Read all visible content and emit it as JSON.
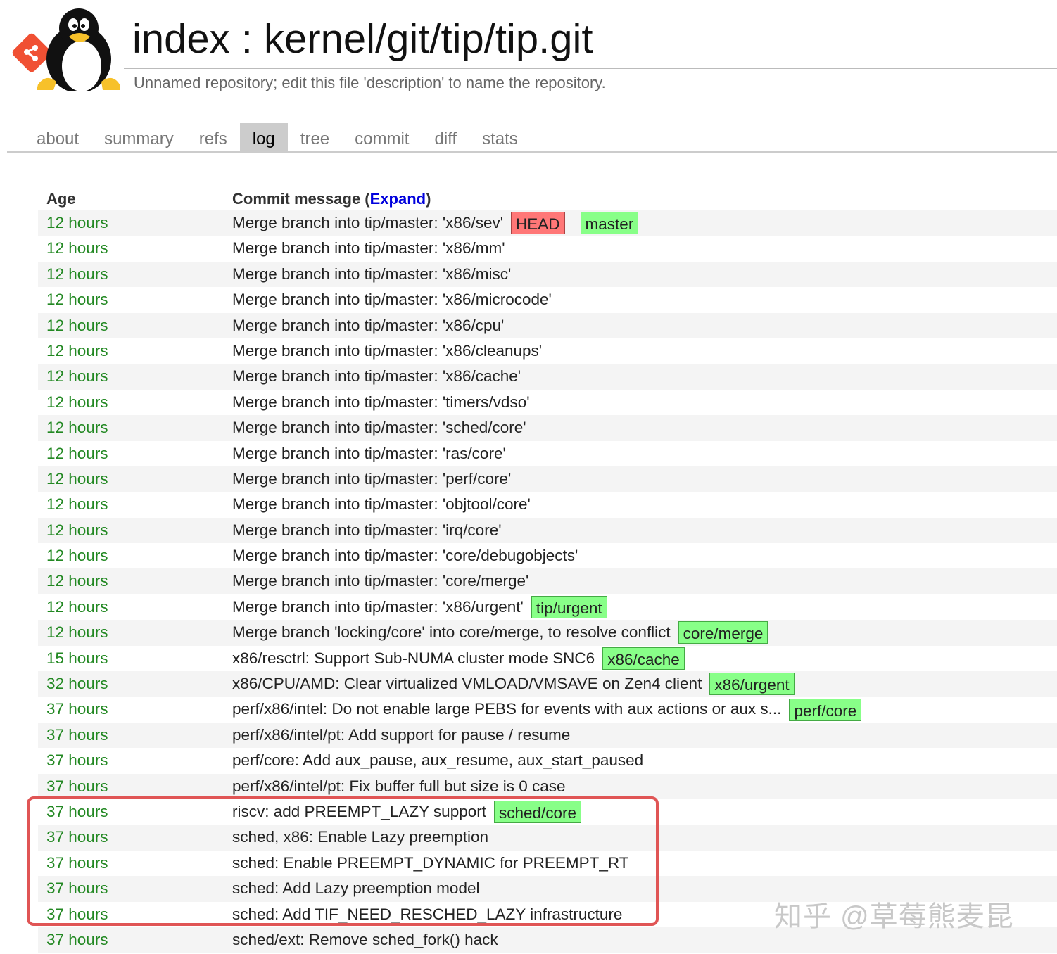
{
  "header": {
    "title": "index : kernel/git/tip/tip.git",
    "description": "Unnamed repository; edit this file 'description' to name the repository."
  },
  "tabs": [
    {
      "label": "about",
      "active": false
    },
    {
      "label": "summary",
      "active": false
    },
    {
      "label": "refs",
      "active": false
    },
    {
      "label": "log",
      "active": true
    },
    {
      "label": "tree",
      "active": false
    },
    {
      "label": "commit",
      "active": false
    },
    {
      "label": "diff",
      "active": false
    },
    {
      "label": "stats",
      "active": false
    }
  ],
  "log": {
    "columns": {
      "age": "Age",
      "message_prefix": "Commit message (",
      "expand": "Expand",
      "message_suffix": ")"
    },
    "rows": [
      {
        "age": "12 hours",
        "message": "Merge branch into tip/master: 'x86/sev'",
        "decorations": [
          {
            "label": "HEAD",
            "kind": "head"
          },
          {
            "label": "master",
            "kind": "branch"
          }
        ]
      },
      {
        "age": "12 hours",
        "message": "Merge branch into tip/master: 'x86/mm'",
        "decorations": []
      },
      {
        "age": "12 hours",
        "message": "Merge branch into tip/master: 'x86/misc'",
        "decorations": []
      },
      {
        "age": "12 hours",
        "message": "Merge branch into tip/master: 'x86/microcode'",
        "decorations": []
      },
      {
        "age": "12 hours",
        "message": "Merge branch into tip/master: 'x86/cpu'",
        "decorations": []
      },
      {
        "age": "12 hours",
        "message": "Merge branch into tip/master: 'x86/cleanups'",
        "decorations": []
      },
      {
        "age": "12 hours",
        "message": "Merge branch into tip/master: 'x86/cache'",
        "decorations": []
      },
      {
        "age": "12 hours",
        "message": "Merge branch into tip/master: 'timers/vdso'",
        "decorations": []
      },
      {
        "age": "12 hours",
        "message": "Merge branch into tip/master: 'sched/core'",
        "decorations": []
      },
      {
        "age": "12 hours",
        "message": "Merge branch into tip/master: 'ras/core'",
        "decorations": []
      },
      {
        "age": "12 hours",
        "message": "Merge branch into tip/master: 'perf/core'",
        "decorations": []
      },
      {
        "age": "12 hours",
        "message": "Merge branch into tip/master: 'objtool/core'",
        "decorations": []
      },
      {
        "age": "12 hours",
        "message": "Merge branch into tip/master: 'irq/core'",
        "decorations": []
      },
      {
        "age": "12 hours",
        "message": "Merge branch into tip/master: 'core/debugobjects'",
        "decorations": []
      },
      {
        "age": "12 hours",
        "message": "Merge branch into tip/master: 'core/merge'",
        "decorations": []
      },
      {
        "age": "12 hours",
        "message": "Merge branch into tip/master: 'x86/urgent'",
        "decorations": [
          {
            "label": "tip/urgent",
            "kind": "branch"
          }
        ]
      },
      {
        "age": "12 hours",
        "message": "Merge branch 'locking/core' into core/merge, to resolve conflict",
        "decorations": [
          {
            "label": "core/merge",
            "kind": "branch"
          }
        ]
      },
      {
        "age": "15 hours",
        "message": "x86/resctrl: Support Sub-NUMA cluster mode SNC6",
        "decorations": [
          {
            "label": "x86/cache",
            "kind": "branch"
          }
        ]
      },
      {
        "age": "32 hours",
        "message": "x86/CPU/AMD: Clear virtualized VMLOAD/VMSAVE on Zen4 client",
        "decorations": [
          {
            "label": "x86/urgent",
            "kind": "branch"
          }
        ]
      },
      {
        "age": "37 hours",
        "message": "perf/x86/intel: Do not enable large PEBS for events with aux actions or aux s...",
        "decorations": [
          {
            "label": "perf/core",
            "kind": "branch"
          }
        ]
      },
      {
        "age": "37 hours",
        "message": "perf/x86/intel/pt: Add support for pause / resume",
        "decorations": []
      },
      {
        "age": "37 hours",
        "message": "perf/core: Add aux_pause, aux_resume, aux_start_paused",
        "decorations": []
      },
      {
        "age": "37 hours",
        "message": "perf/x86/intel/pt: Fix buffer full but size is 0 case",
        "decorations": []
      },
      {
        "age": "37 hours",
        "message": "riscv: add PREEMPT_LAZY support",
        "decorations": [
          {
            "label": "sched/core",
            "kind": "branch"
          }
        ]
      },
      {
        "age": "37 hours",
        "message": "sched, x86: Enable Lazy preemption",
        "decorations": []
      },
      {
        "age": "37 hours",
        "message": "sched: Enable PREEMPT_DYNAMIC for PREEMPT_RT",
        "decorations": []
      },
      {
        "age": "37 hours",
        "message": "sched: Add Lazy preemption model",
        "decorations": []
      },
      {
        "age": "37 hours",
        "message": "sched: Add TIF_NEED_RESCHED_LAZY infrastructure",
        "decorations": []
      },
      {
        "age": "37 hours",
        "message": "sched/ext: Remove sched_fork() hack",
        "decorations": []
      }
    ]
  },
  "watermark": "知乎 @草莓熊麦昆",
  "colors": {
    "age_text": "#228822",
    "head_badge": "#ff7777",
    "branch_badge": "#88ff88",
    "expand_link": "#0000dd",
    "highlight_border": "#e05555",
    "active_tab_bg": "#cccccc"
  }
}
